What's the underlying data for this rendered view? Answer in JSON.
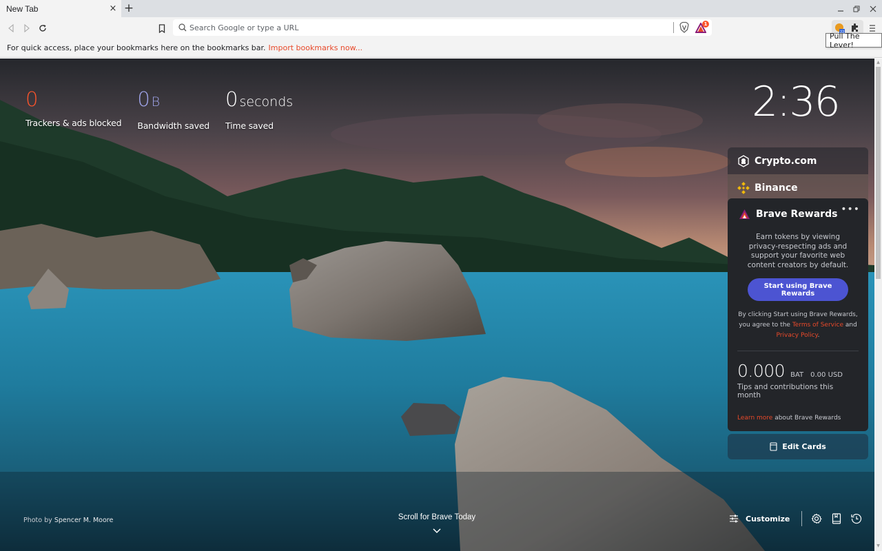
{
  "browser": {
    "tab": {
      "title": "New Tab",
      "close_glyph": "×"
    },
    "new_tab_glyph": "+",
    "window_controls": {
      "minimize": "–",
      "restore": "❐",
      "close": "✕"
    },
    "omnibox": {
      "placeholder": "Search Google or type a URL",
      "value": ""
    },
    "rewards_badge_count": "1",
    "tooltip": "Pull The Lever!",
    "bookmarks_bar": {
      "message": "For quick access, place your bookmarks here on the bookmarks bar.",
      "import_link": "Import bookmarks now..."
    },
    "icons": [
      "back-icon",
      "forward-icon",
      "reload-icon",
      "bookmark-icon",
      "search-icon",
      "brave-shields-icon",
      "brave-rewards-icon",
      "extension-lever-icon",
      "extensions-puzzle-icon",
      "menu-icon"
    ]
  },
  "ntp": {
    "stats": [
      {
        "value": "0",
        "unit": "",
        "label": "Trackers & ads blocked",
        "color": "#fb542b"
      },
      {
        "value": "0",
        "unit": "B",
        "label": "Bandwidth saved",
        "color": "#a0a5eb"
      },
      {
        "value": "0",
        "unit": "seconds",
        "label": "Time saved",
        "color": "#ffffff"
      }
    ],
    "clock": "2:36",
    "cards": {
      "crypto": {
        "label": "Crypto.com"
      },
      "binance": {
        "label": "Binance"
      },
      "rewards": {
        "title": "Brave Rewards",
        "more_glyph": "•••",
        "description": "Earn tokens by viewing privacy-respecting ads and support your favorite web content creators by default.",
        "start_button": "Start using Brave Rewards",
        "terms_prefix": "By clicking Start using Brave Rewards, you agree to the",
        "terms_link": "Terms of Service",
        "terms_and": "and",
        "privacy_link": "Privacy Policy",
        "terms_suffix": ".",
        "balance_bat": "0.000",
        "bat_unit": "BAT",
        "balance_usd": "0.00 USD",
        "tips_label": "Tips and contributions this month",
        "learn_more_link": "Learn more",
        "learn_more_suffix": "about Brave Rewards"
      },
      "edit_cards": "Edit Cards"
    },
    "photo_credit": {
      "prefix": "Photo by",
      "author": "Spencer M. Moore"
    },
    "scroll_today": "Scroll for Brave Today",
    "customize": "Customize",
    "accent_colors": {
      "brave_orange": "#fb542b",
      "rewards_button": "#4c54d2",
      "link": "#e8492a"
    }
  }
}
